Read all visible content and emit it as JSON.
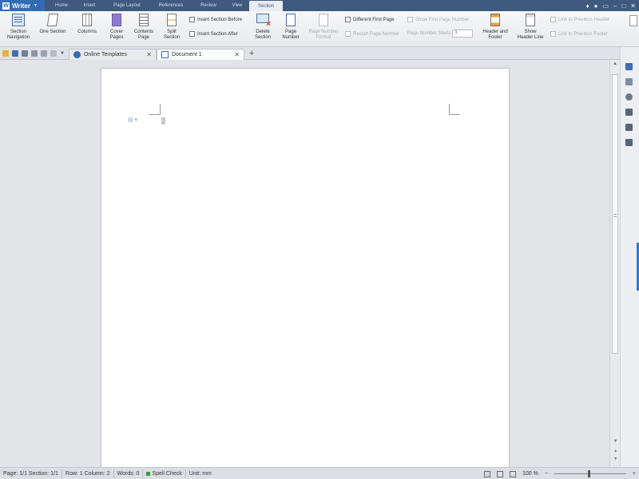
{
  "app": {
    "name": "Writer",
    "logo": "W"
  },
  "menu": [
    "Home",
    "Insert",
    "Page Layout",
    "References",
    "Review",
    "View",
    "Section"
  ],
  "active_menu": "Section",
  "ribbon": {
    "section_navigation": "Section\nNavigation",
    "one_section": "One Section",
    "columns": "Columns",
    "cover_pages": "Cover\nPages",
    "contents_page": "Contents\nPage",
    "split_section": "Split\nSection",
    "insert_before": "Insert Section Before",
    "insert_after": "Insert Section After",
    "delete_section": "Delete\nSection",
    "page_number": "Page\nNumber",
    "page_number_format": "Page Number\nFormat",
    "different_first_page": "Different First Page",
    "restart_page_number": "Restart Page Number",
    "show_first_page_number": "Show First Page Number",
    "page_number_starts": "Page Number Starts",
    "page_number_start_value": "1",
    "header_footer": "Header and\nFooter",
    "show_header_line": "Show\nHeader Line",
    "link_prev_header": "Link to Previous Header",
    "link_prev_footer": "Link to Previous Footer"
  },
  "tabs": [
    {
      "label": "Online Templates",
      "active": false
    },
    {
      "label": "Document 1",
      "active": true
    }
  ],
  "status": {
    "page": "Page: 1/1 Section: 1/1",
    "row": "Row: 1 Column: 2",
    "words": "Words: 0",
    "spell": "Spell Check",
    "unit": "Unit: mm",
    "zoom": "100 %",
    "zoom_minus": "−",
    "zoom_plus": "+"
  },
  "colors": {
    "title_bar": "#3f5a7e",
    "app_button": "#2f6db6",
    "accent": "#3a78c3"
  }
}
